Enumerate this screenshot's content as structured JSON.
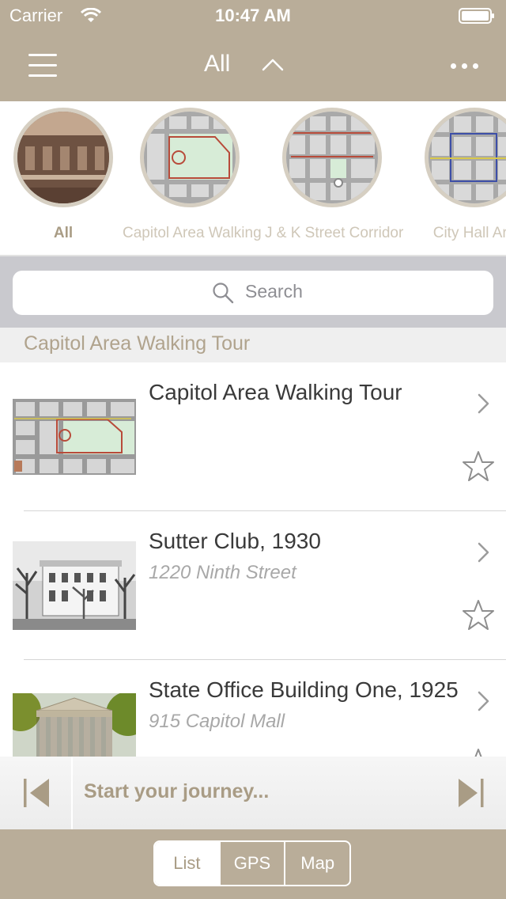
{
  "status_bar": {
    "carrier": "Carrier",
    "time": "10:47 AM"
  },
  "nav": {
    "title": "All",
    "menu_icon": "hamburger-icon",
    "chevron_icon": "chevron-up-icon",
    "more_icon": "ellipsis-icon"
  },
  "categories": [
    {
      "label": "All",
      "active": true
    },
    {
      "label": "Capitol Area Walking",
      "active": false
    },
    {
      "label": "J & K Street Corridor",
      "active": false
    },
    {
      "label": "City Hall Are",
      "active": false
    }
  ],
  "search": {
    "placeholder": "Search"
  },
  "section": {
    "title": "Capitol Area Walking Tour"
  },
  "items": [
    {
      "title": "Capitol Area Walking Tour",
      "subtitle": ""
    },
    {
      "title": "Sutter Club, 1930",
      "subtitle": "1220 Ninth Street"
    },
    {
      "title": "State Office Building One, 1925",
      "subtitle": "915 Capitol Mall"
    }
  ],
  "player": {
    "text": "Start your journey..."
  },
  "tabs": [
    {
      "label": "List",
      "active": true
    },
    {
      "label": "GPS",
      "active": false
    },
    {
      "label": "Map",
      "active": false
    }
  ],
  "colors": {
    "brand": "#b9ad99",
    "accent_text": "#a99c85"
  }
}
